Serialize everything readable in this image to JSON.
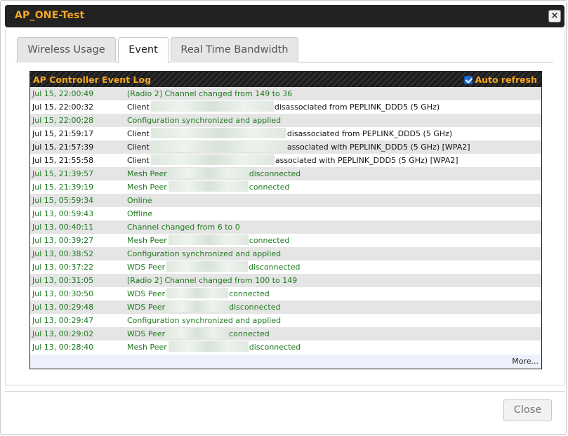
{
  "window": {
    "title": "AP_ONE-Test",
    "close_glyph": "×"
  },
  "tabs": [
    {
      "label": "Wireless Usage",
      "active": false
    },
    {
      "label": "Event",
      "active": true
    },
    {
      "label": "Real Time Bandwidth",
      "active": false
    }
  ],
  "log": {
    "title": "AP Controller Event Log",
    "auto_refresh_label": "Auto refresh",
    "auto_refresh_checked": true,
    "more_label": "More...",
    "colors": {
      "green": "#1e7b1e",
      "black": "#111111",
      "accent": "#f5a623"
    },
    "rows": [
      {
        "time": "Jul 15, 22:00:49",
        "color": "green",
        "before": "[Radio 2] Channel changed from 149 to 36",
        "redacted": false,
        "after": ""
      },
      {
        "time": "Jul 15, 22:00:32",
        "color": "black",
        "before": "Client",
        "redacted": true,
        "after": "disassociated from PEPLINK_DDD5 (5 GHz)"
      },
      {
        "time": "Jul 15, 22:00:28",
        "color": "green",
        "before": "Configuration synchronized and applied",
        "redacted": false,
        "after": ""
      },
      {
        "time": "Jul 15, 21:59:17",
        "color": "black",
        "before": "Client",
        "redacted": true,
        "after": "disassociated from PEPLINK_DDD5 (5 GHz)"
      },
      {
        "time": "Jul 15, 21:57:39",
        "color": "black",
        "before": "Client",
        "redacted": true,
        "after": "associated with PEPLINK_DDD5 (5 GHz) [WPA2]"
      },
      {
        "time": "Jul 15, 21:55:58",
        "color": "black",
        "before": "Client",
        "redacted": true,
        "after": "associated with PEPLINK_DDD5 (5 GHz) [WPA2]"
      },
      {
        "time": "Jul 15, 21:39:57",
        "color": "green",
        "before": "Mesh Peer",
        "redacted": true,
        "after": "disconnected"
      },
      {
        "time": "Jul 15, 21:39:19",
        "color": "green",
        "before": "Mesh Peer",
        "redacted": true,
        "after": "connected"
      },
      {
        "time": "Jul 15, 05:59:34",
        "color": "green",
        "before": "Online",
        "redacted": false,
        "after": ""
      },
      {
        "time": "Jul 13, 00:59:43",
        "color": "green",
        "before": "Offline",
        "redacted": false,
        "after": ""
      },
      {
        "time": "Jul 13, 00:40:11",
        "color": "green",
        "before": "Channel changed from 6 to 0",
        "redacted": false,
        "after": ""
      },
      {
        "time": "Jul 13, 00:39:27",
        "color": "green",
        "before": "Mesh Peer",
        "redacted": true,
        "after": "connected"
      },
      {
        "time": "Jul 13, 00:38:52",
        "color": "green",
        "before": "Configuration synchronized and applied",
        "redacted": false,
        "after": ""
      },
      {
        "time": "Jul 13, 00:37:22",
        "color": "green",
        "before": "WDS Peer",
        "redacted": true,
        "after": "disconnected"
      },
      {
        "time": "Jul 13, 00:31:05",
        "color": "green",
        "before": "[Radio 2] Channel changed from 100 to 149",
        "redacted": false,
        "after": ""
      },
      {
        "time": "Jul 13, 00:30:50",
        "color": "green",
        "before": "WDS Peer",
        "redacted": true,
        "after": "connected"
      },
      {
        "time": "Jul 13, 00:29:48",
        "color": "green",
        "before": "WDS Peer",
        "redacted": true,
        "after": "disconnected"
      },
      {
        "time": "Jul 13, 00:29:47",
        "color": "green",
        "before": "Configuration synchronized and applied",
        "redacted": false,
        "after": ""
      },
      {
        "time": "Jul 13, 00:29:02",
        "color": "green",
        "before": "WDS Peer",
        "redacted": true,
        "after": "connected"
      },
      {
        "time": "Jul 13, 00:28:40",
        "color": "green",
        "before": "Mesh Peer",
        "redacted": true,
        "after": "disconnected"
      }
    ]
  },
  "footer": {
    "close_label": "Close"
  }
}
